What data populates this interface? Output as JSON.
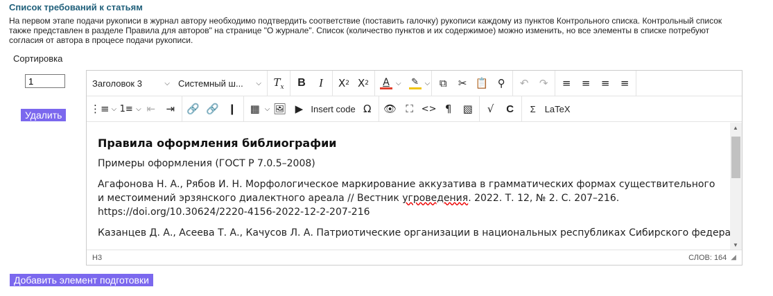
{
  "section_title": "Список требований к статьям",
  "description": "На первом этапе подачи рукописи в журнал автору необходимо подтвердить соответствие (поставить галочку) рукописи каждому из пунктов Контрольного списка. Контрольный список также представлен в разделе Правила для авторов\" на странице \"О журнале\". Список (количество пунктов и их содержимое) можно изменить, но все элементы в списке потребуют согласия от автора в процесе подачи рукописи.",
  "sort": {
    "label": "Сортировка",
    "value": "1"
  },
  "delete_label": "Удалить",
  "add_label": "Добавить элемент подготовки",
  "toolbar": {
    "block_format": "Заголовок 3",
    "font_family": "Системный ш...",
    "insert_code": "Insert code",
    "sigma": "Σ",
    "latex": "LaTeX"
  },
  "content": {
    "heading": "Правила оформления библиографии",
    "p1": "Примеры оформления (ГОСТ Р 7.0.5–2008)",
    "p2_a": "Агафонова Н. А., Рябов И. Н. Морфологическое маркирование аккузатива в грамматических формах существительного и местоимений эрзянского диалектного ареала // Вестник ",
    "p2_spell": "угроведения",
    "p2_b": ". 2022. Т. 12, № 2. С. 207–216. https://doi.org/10.30624/2220-4156-2022-12-2-207-216",
    "p3": "Казанцев Д. А., Асеева Т. А., Качусов Л. А. Патриотические организации в национальных республиках Сибирского федерального"
  },
  "status": {
    "path": "H3",
    "word_count": "СЛОВ: 164"
  },
  "colors": {
    "accent": "#7b68ee",
    "title": "#1f5f7a"
  }
}
